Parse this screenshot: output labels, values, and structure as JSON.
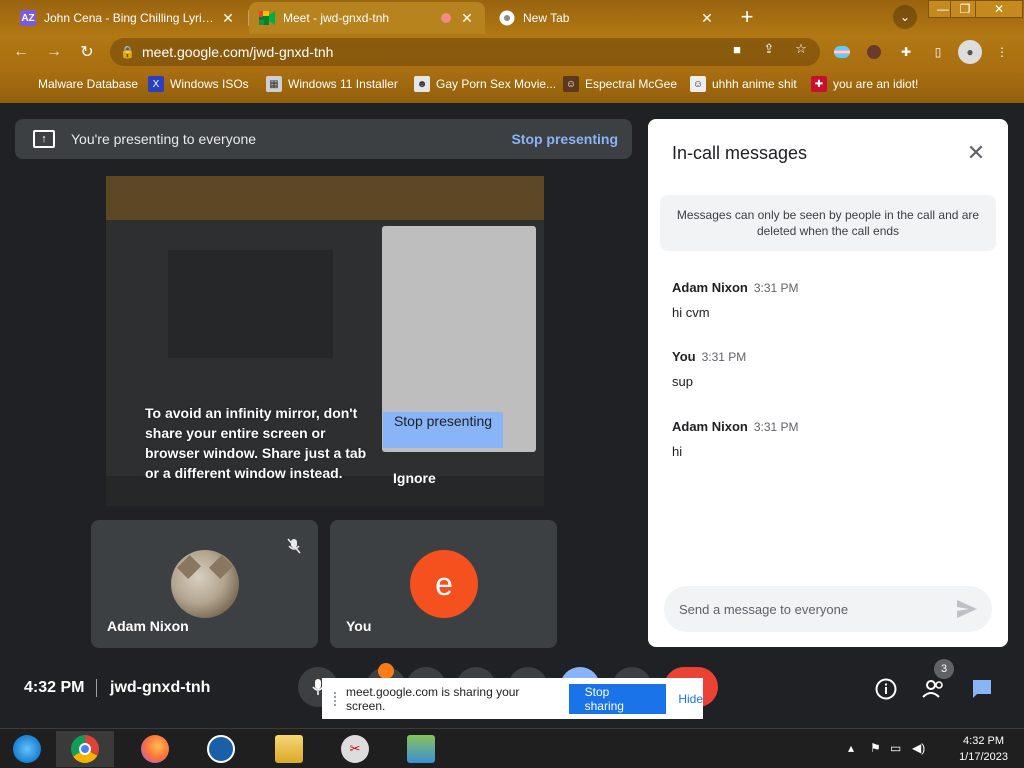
{
  "browser": {
    "tabs": [
      {
        "title": "John Cena - Bing Chilling Lyrics |",
        "favicon": "AZ"
      },
      {
        "title": "Meet - jwd-gnxd-tnh",
        "favicon": "meet"
      },
      {
        "title": "New Tab",
        "favicon": "chrome"
      }
    ],
    "url": "meet.google.com/jwd-gnxd-tnh",
    "bookmarks": [
      "Malware Database",
      "Windows ISOs",
      "Windows 11 Installer",
      "Gay Porn Sex Movie...",
      "Espectral McGee",
      "uhhh anime shit",
      "you are an idiot!"
    ]
  },
  "meet": {
    "presenting_text": "You're presenting to everyone",
    "stop_presenting": "Stop presenting",
    "mirror_warning": "To avoid an infinity mirror, don't share your entire screen or browser window. Share just a tab or a different window instead.",
    "mirror_stop": "Stop presenting",
    "mirror_ignore": "Ignore",
    "participants": [
      {
        "name": "Adam Nixon"
      },
      {
        "name": "You",
        "initial": "e"
      }
    ],
    "time": "4:32 PM",
    "code": "jwd-gnxd-tnh",
    "people_count": "3"
  },
  "chat": {
    "title": "In-call messages",
    "notice": "Messages can only be seen by people in the call and are deleted when the call ends",
    "messages": [
      {
        "sender": "Adam Nixon",
        "time": "3:31 PM",
        "text": "hi cvm"
      },
      {
        "sender": "You",
        "time": "3:31 PM",
        "text": "sup"
      },
      {
        "sender": "Adam Nixon",
        "time": "3:31 PM",
        "text": "hi"
      }
    ],
    "placeholder": "Send a message to everyone"
  },
  "share_banner": {
    "text": "meet.google.com is sharing your screen.",
    "stop": "Stop sharing",
    "hide": "Hide"
  },
  "taskbar": {
    "time": "4:32 PM",
    "date": "1/17/2023"
  },
  "colors": {
    "accent_blue": "#8ab4f8",
    "meet_bg": "#202124",
    "avatar_orange": "#f4511e",
    "end_call_red": "#ea4335"
  }
}
